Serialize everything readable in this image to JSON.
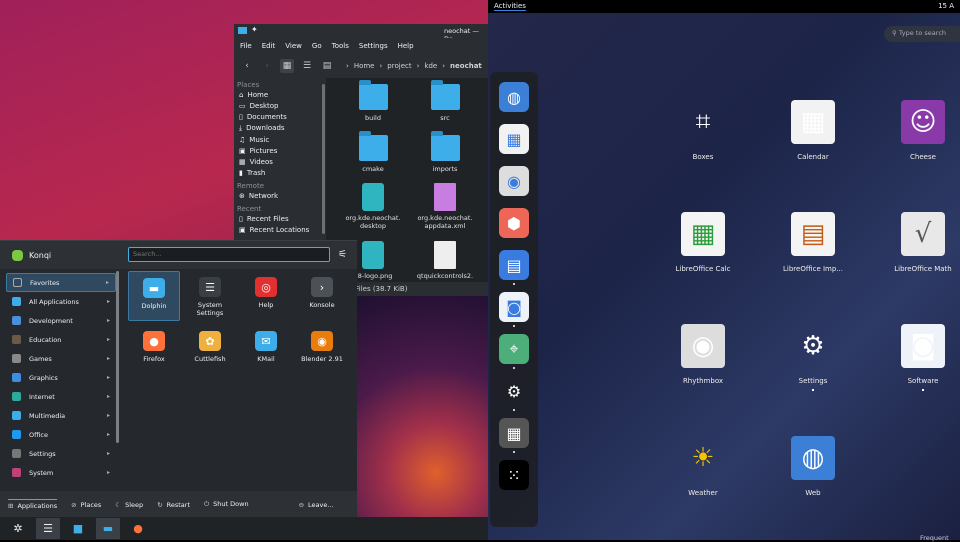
{
  "kde": {
    "dolphin": {
      "title": "neochat — Do",
      "menu": [
        "File",
        "Edit",
        "View",
        "Go",
        "Tools",
        "Settings",
        "Help"
      ],
      "breadcrumb": [
        "Home",
        "project",
        "kde",
        "neochat"
      ],
      "places_header": "Places",
      "places": [
        "Home",
        "Desktop",
        "Documents",
        "Downloads",
        "Music",
        "Pictures",
        "Videos",
        "Trash"
      ],
      "remote_header": "Remote",
      "remote": [
        "Network"
      ],
      "recent_header": "Recent",
      "recent": [
        "Recent Files",
        "Recent Locations"
      ],
      "files": [
        {
          "name": "build",
          "type": "folder"
        },
        {
          "name": "src",
          "type": "folder"
        },
        {
          "name": "cmake",
          "type": "folder"
        },
        {
          "name": "imports",
          "type": "folder"
        },
        {
          "name": "org.kde.neochat.\ndesktop",
          "type": "desktop"
        },
        {
          "name": "org.kde.neochat.\nappdata.xml",
          "type": "xml"
        },
        {
          "name": "28-logo.png",
          "type": "image"
        },
        {
          "name": "qtquickcontrols2.",
          "type": "text"
        }
      ],
      "status": "s, 12 Files (38.7 KiB)"
    },
    "kickoff": {
      "user": "Konqi",
      "search_placeholder": "Search...",
      "categories": [
        {
          "label": "Favorites",
          "color": "#2f4a60"
        },
        {
          "label": "All Applications",
          "color": "#3daee9"
        },
        {
          "label": "Development",
          "color": "#4a90d9"
        },
        {
          "label": "Education",
          "color": "#6b5a48"
        },
        {
          "label": "Games",
          "color": "#888"
        },
        {
          "label": "Graphics",
          "color": "#3d8ee0"
        },
        {
          "label": "Internet",
          "color": "#2eaa9a"
        },
        {
          "label": "Multimedia",
          "color": "#3daee9"
        },
        {
          "label": "Office",
          "color": "#1d99f3"
        },
        {
          "label": "Settings",
          "color": "#777"
        },
        {
          "label": "System",
          "color": "#c0407a"
        }
      ],
      "favorites": [
        {
          "label": "Dolphin",
          "icon": "folder-icon",
          "color": "#3daee9"
        },
        {
          "label": "System Settings",
          "icon": "sliders-icon",
          "color": "#3a3f44"
        },
        {
          "label": "Help",
          "icon": "lifebuoy-icon",
          "color": "#e03030"
        },
        {
          "label": "Konsole",
          "icon": "terminal-icon",
          "color": "#4b5157"
        },
        {
          "label": "Firefox",
          "icon": "firefox-icon",
          "color": "#ff7139"
        },
        {
          "label": "Cuttlefish",
          "icon": "cuttlefish-icon",
          "color": "#f0b040"
        },
        {
          "label": "KMail",
          "icon": "mail-icon",
          "color": "#3daee9"
        },
        {
          "label": "Blender 2.91",
          "icon": "blender-icon",
          "color": "#e87d0d"
        }
      ],
      "footer": {
        "applications": "Applications",
        "places": "Places",
        "sleep": "Sleep",
        "restart": "Restart",
        "shutdown": "Shut Down",
        "leave": "Leave..."
      }
    }
  },
  "gnome": {
    "activities": "Activities",
    "clock": "15 A",
    "search_placeholder": "Type to search",
    "dash": [
      {
        "icon": "web-icon",
        "running": false
      },
      {
        "icon": "calendar-icon",
        "running": false
      },
      {
        "icon": "rhythmbox-icon",
        "running": false
      },
      {
        "icon": "color-icon",
        "running": false
      },
      {
        "icon": "files-icon",
        "running": true
      },
      {
        "icon": "software-icon",
        "running": true
      },
      {
        "icon": "maps-icon",
        "running": true
      },
      {
        "icon": "settings-icon",
        "running": true
      },
      {
        "icon": "calculator-icon",
        "running": true
      },
      {
        "icon": "app-grid-icon",
        "running": false
      }
    ],
    "apps": [
      {
        "label": "Boxes",
        "icon": "boxes-icon",
        "running": false
      },
      {
        "label": "Calendar",
        "icon": "calendar-icon",
        "running": false
      },
      {
        "label": "Cheese",
        "icon": "cheese-icon",
        "running": false
      },
      {
        "label": "LibreOffice Calc",
        "icon": "calc-icon",
        "running": false
      },
      {
        "label": "LibreOffice Imp...",
        "icon": "impress-icon",
        "running": false
      },
      {
        "label": "LibreOffice Math",
        "icon": "math-icon",
        "running": false
      },
      {
        "label": "Rhythmbox",
        "icon": "rhythmbox-icon",
        "running": false
      },
      {
        "label": "Settings",
        "icon": "settings-icon",
        "running": true
      },
      {
        "label": "Software",
        "icon": "software-icon",
        "running": true
      },
      {
        "label": "Weather",
        "icon": "weather-icon",
        "running": false
      },
      {
        "label": "Web",
        "icon": "web-icon",
        "running": false
      }
    ],
    "frequent": "Frequent"
  }
}
